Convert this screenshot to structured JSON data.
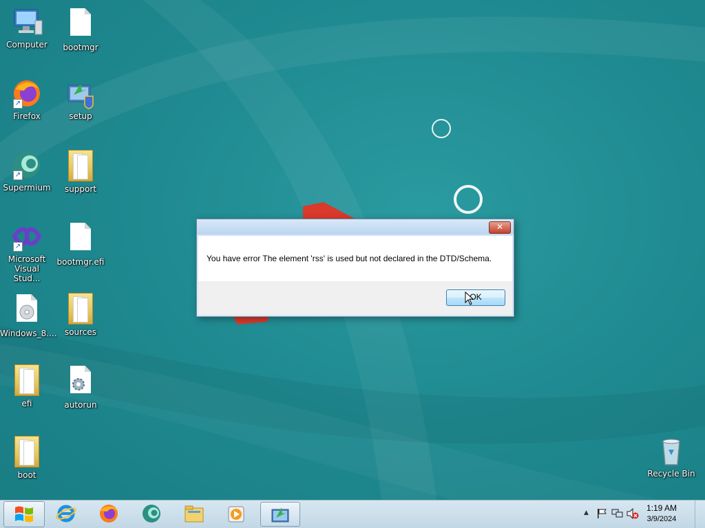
{
  "desktop": {
    "icons": [
      {
        "label": "Computer"
      },
      {
        "label": "bootmgr"
      },
      {
        "label": "Firefox"
      },
      {
        "label": "setup"
      },
      {
        "label": "Supermium"
      },
      {
        "label": "support"
      },
      {
        "label": "Microsoft Visual Stud..."
      },
      {
        "label": "bootmgr.efi"
      },
      {
        "label": "Windows_8...."
      },
      {
        "label": "sources"
      },
      {
        "label": "efi"
      },
      {
        "label": "autorun"
      },
      {
        "label": "boot"
      },
      {
        "label": "Recycle Bin"
      }
    ]
  },
  "dialog": {
    "message": "You have error The element 'rss' is used but not declared in the DTD/Schema.",
    "ok_label": "OK",
    "close_glyph": "✕"
  },
  "taskbar": {
    "items": [
      {
        "icon": "internet-explorer-icon"
      },
      {
        "icon": "firefox-icon"
      },
      {
        "icon": "supermium-icon"
      },
      {
        "icon": "file-explorer-icon"
      },
      {
        "icon": "media-player-icon"
      },
      {
        "icon": "setup-app-icon"
      }
    ],
    "clock": {
      "time": "1:19 AM",
      "date": "3/9/2024"
    }
  },
  "colors": {
    "desktop": "#1f8a91",
    "dialog_frame": "#cfe3f7",
    "accent_red": "#d93a2b"
  }
}
